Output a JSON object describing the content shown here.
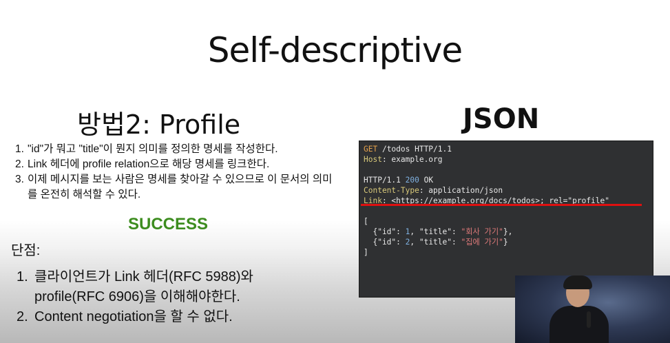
{
  "slide": {
    "title": "Self-descriptive",
    "left_heading": "방법2: Profile",
    "right_heading": "JSON",
    "steps": [
      {
        "num": "1.",
        "text": "\"id\"가 뭐고 \"title\"이 뭔지 의미를 정의한 명세를 작성한다."
      },
      {
        "num": "2.",
        "text": "Link 헤더에 profile relation으로 해당 명세를 링크한다."
      },
      {
        "num": "3.",
        "text": "이제 메시지를 보는 사람은 명세를 찾아갈 수 있으므로 이 문서의 의미를 온전히 해석할 수 있다."
      }
    ],
    "success": "SUCCESS",
    "cons_heading": "단점:",
    "cons": [
      {
        "num": "1.",
        "text": "클라이언트가 Link 헤더(RFC 5988)와 profile(RFC 6906)을 이해해야한다."
      },
      {
        "num": "2.",
        "text": "Content negotiation을 할 수 없다."
      }
    ],
    "colors": {
      "success": "#3c8c1e",
      "underline": "#e01010",
      "code_bg": "#2f3032"
    }
  },
  "code": {
    "req_method": "GET",
    "req_path": " /todos HTTP/1.1",
    "host_key": "Host",
    "host_val": ": example.org",
    "resp_status_pre": "HTTP/1.1 ",
    "resp_status_code": "200",
    "resp_status_post": " OK",
    "ct_key": "Content-Type",
    "ct_val": ": application/json",
    "link_key": "Link",
    "link_val": ": <https://example.org/docs/todos>; rel=\"profile\"",
    "open_bracket": "[",
    "item1_a": "  {\"id\": ",
    "item1_num": "1",
    "item1_b": ", \"title\": ",
    "item1_str": "\"회사 가기\"",
    "item1_c": "},",
    "item2_a": "  {\"id\": ",
    "item2_num": "2",
    "item2_b": ", \"title\": ",
    "item2_str": "\"집에 가기\"",
    "item2_c": "}",
    "close_bracket": "]"
  }
}
